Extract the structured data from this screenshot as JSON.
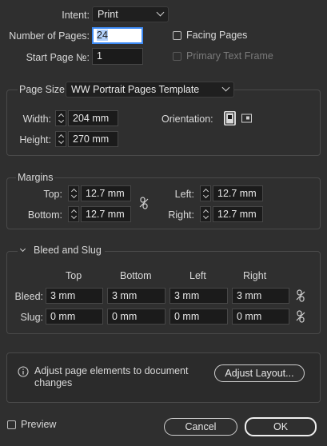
{
  "top": {
    "intent_label": "Intent:",
    "intent_value": "Print",
    "pages_label": "Number of Pages:",
    "pages_value": "24",
    "start_label": "Start Page №:",
    "start_value": "1",
    "facing_label": "Facing Pages",
    "primary_label": "Primary Text Frame"
  },
  "page_size": {
    "label": "Page Size:",
    "value": "WW Portrait Pages Template",
    "width_label": "Width:",
    "width_value": "204 mm",
    "height_label": "Height:",
    "height_value": "270 mm",
    "orientation_label": "Orientation:"
  },
  "margins": {
    "title": "Margins",
    "top_label": "Top:",
    "top_value": "12.7 mm",
    "bottom_label": "Bottom:",
    "bottom_value": "12.7 mm",
    "left_label": "Left:",
    "left_value": "12.7 mm",
    "right_label": "Right:",
    "right_value": "12.7 mm"
  },
  "bleed_slug": {
    "title": "Bleed and Slug",
    "col_top": "Top",
    "col_bottom": "Bottom",
    "col_left": "Left",
    "col_right": "Right",
    "bleed_label": "Bleed:",
    "bleed": [
      "3 mm",
      "3 mm",
      "3 mm",
      "3 mm"
    ],
    "slug_label": "Slug:",
    "slug": [
      "0 mm",
      "0 mm",
      "0 mm",
      "0 mm"
    ]
  },
  "info": {
    "text_line1": "Adjust page elements to document",
    "text_line2": "changes",
    "button": "Adjust Layout..."
  },
  "footer": {
    "preview_label": "Preview",
    "cancel": "Cancel",
    "ok": "OK"
  },
  "colors": {
    "background": "#2f2f2f",
    "field_bg": "#1b1b1b",
    "focus_ring": "#3d8bf6"
  }
}
